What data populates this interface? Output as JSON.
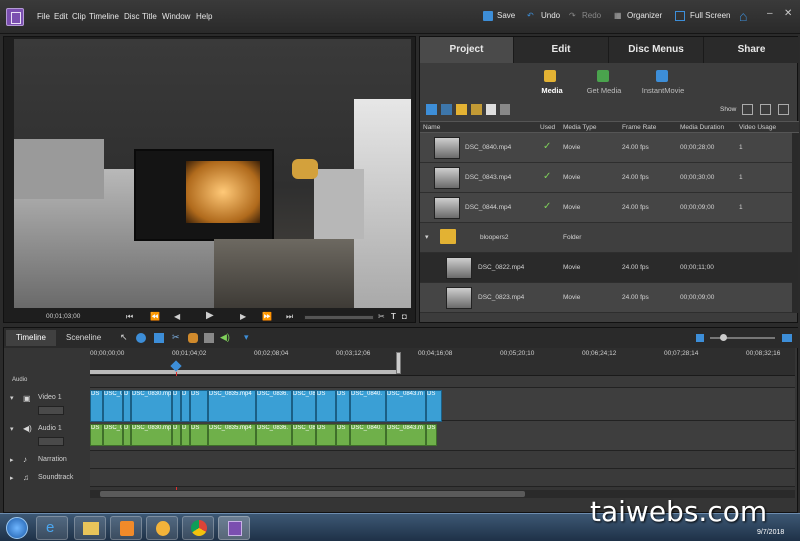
{
  "app": {
    "menus": [
      "File",
      "Edit",
      "Clip",
      "Timeline",
      "Disc",
      "Title",
      "Window",
      "Help"
    ]
  },
  "toolbar": {
    "save": "Save",
    "undo": "Undo",
    "redo": "Redo",
    "organizer": "Organizer",
    "fullscreen": "Full Screen"
  },
  "monitor": {
    "timecode": "00;01;03;00"
  },
  "panel": {
    "tabs": [
      "Project",
      "Edit",
      "Disc Menus",
      "Share"
    ],
    "subtabs": [
      "Media",
      "Get Media",
      "InstantMovie"
    ],
    "show_label": "Show",
    "columns": [
      "Name",
      "Used",
      "Media Type",
      "Frame Rate",
      "Media Duration",
      "Video Usage"
    ],
    "rows": [
      {
        "name": "DSC_0840.mp4",
        "used": "✓",
        "type": "Movie",
        "fps": "24.00 fps",
        "dur": "00;00;28;00",
        "usage": "1"
      },
      {
        "name": "DSC_0843.mp4",
        "used": "✓",
        "type": "Movie",
        "fps": "24.00 fps",
        "dur": "00;00;30;00",
        "usage": "1"
      },
      {
        "name": "DSC_0844.mp4",
        "used": "✓",
        "type": "Movie",
        "fps": "24.00 fps",
        "dur": "00;00;09;00",
        "usage": "1"
      },
      {
        "name": "bloopers2",
        "used": "",
        "type": "Folder",
        "fps": "",
        "dur": "",
        "usage": ""
      },
      {
        "name": "DSC_0822.mp4",
        "used": "",
        "type": "Movie",
        "fps": "24.00 fps",
        "dur": "00;00;11;00",
        "usage": ""
      },
      {
        "name": "DSC_0823.mp4",
        "used": "",
        "type": "Movie",
        "fps": "24.00 fps",
        "dur": "00;00;09;00",
        "usage": ""
      }
    ]
  },
  "timeline": {
    "tabs": [
      "Timeline",
      "Sceneline"
    ],
    "ruler": [
      "00;00;00;00",
      "00;01;04;02",
      "00;02;08;04",
      "00;03;12;06",
      "00;04;16;08",
      "00;05;20;10",
      "00;06;24;12",
      "00;07;28;14",
      "00;08;32;16"
    ],
    "tracks": [
      "Video 1",
      "Audio 1",
      "Narration",
      "Soundtrack"
    ],
    "top_track": "Audio",
    "clips": [
      "DS",
      "DSC_0",
      "D",
      "DSC_0830.mp",
      "D",
      "D",
      "DS",
      "DSC_0835.mp4",
      "DSC_0836.",
      "DSC_08",
      "DS",
      "DSC_0840.",
      "DSC_0843.m",
      "DS"
    ]
  },
  "taskbar": {
    "date": "9/7/2018"
  },
  "watermark": "taiwebs.com"
}
